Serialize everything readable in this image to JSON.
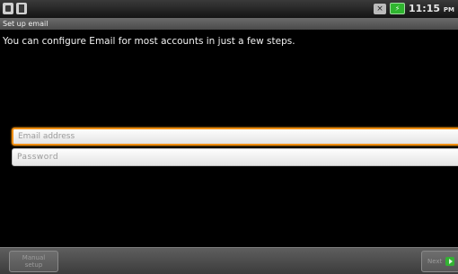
{
  "status_bar": {
    "icons": [
      "usb-debug-icon",
      "sd-card-icon",
      "mute-icon",
      "battery-icon"
    ],
    "time": "11:15",
    "time_suffix": "PM"
  },
  "title_bar": {
    "title": "Set up email"
  },
  "main": {
    "intro_text": "You can configure Email for most accounts in just a few steps.",
    "email_field": {
      "placeholder": "Email address",
      "value": ""
    },
    "password_field": {
      "placeholder": "Password",
      "value": ""
    }
  },
  "bottom_bar": {
    "manual_setup_label": "Manual setup",
    "next_label": "Next"
  },
  "colors": {
    "focus_border": "#ef8e13",
    "battery_green": "#2fb52f"
  }
}
